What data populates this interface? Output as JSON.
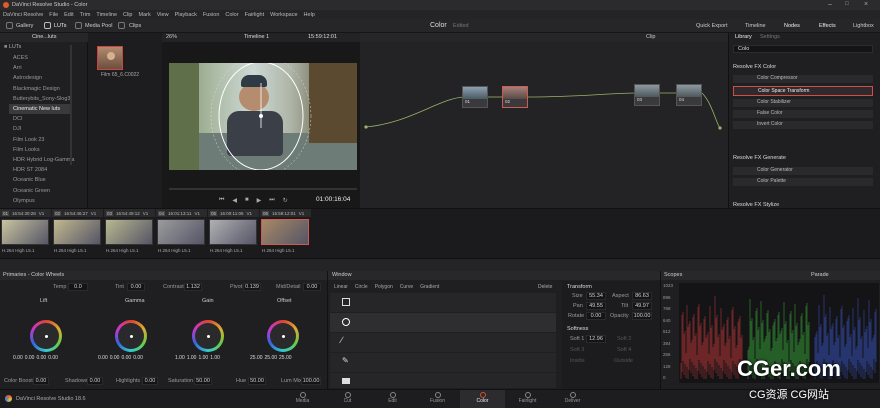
{
  "window": {
    "title": "DaVinci Resolve Studio - Color"
  },
  "menu": [
    "DaVinci Resolve",
    "File",
    "Edit",
    "Trim",
    "Timeline",
    "Clip",
    "Mark",
    "View",
    "Playback",
    "Fusion",
    "Color",
    "Fairlight",
    "Workspace",
    "Help"
  ],
  "toolbar": {
    "gallery": "Gallery",
    "luts": "LUTs",
    "media_pool": "Media Pool",
    "clips": "Clips",
    "page_title": "Color",
    "page_status": "Edited",
    "quick_export": "Quick Export",
    "timeline": "Timeline",
    "nodes": "Nodes",
    "effects": "Effects",
    "lightbox": "Lightbox"
  },
  "lut_panel": {
    "breadcrumb": "Cine...luts",
    "root": "LUTs",
    "items": [
      "ACES",
      "Arri",
      "Astrodesign",
      "Blackmagic Design",
      "Butterybits_Sony-Slog3",
      "Cinematic New luts",
      "DCI",
      "DJI",
      "Film Look 23",
      "Film Looks",
      "HDR Hybrid Log-Gamma",
      "HDR ST 2084",
      "Oceanic Blue",
      "Oceanic Green",
      "Olympus"
    ],
    "selected": "Cinematic New luts",
    "thumb_label": "Film 65_6.C0022"
  },
  "viewer": {
    "zoom": "26%",
    "timeline_name": "Timeline 1",
    "timecode_top": "15:59:12:01",
    "clip_label": "Clip",
    "timecode": "01:00:16:04"
  },
  "nodes": [
    {
      "num": "01"
    },
    {
      "num": "02"
    },
    {
      "num": "03"
    },
    {
      "num": "04"
    }
  ],
  "library": {
    "tab_library": "Library",
    "tab_settings": "Settings",
    "search_value": "Colo",
    "sections": [
      {
        "title": "Resolve FX Color",
        "items": [
          "Color Compressor",
          "Color Space Transform",
          "Color Stabilizer",
          "False Color",
          "Invert Color"
        ]
      },
      {
        "title": "Resolve FX Generate",
        "items": [
          "Color Generator",
          "Color Palette"
        ]
      },
      {
        "title": "Resolve FX Stylize",
        "items": []
      }
    ],
    "highlighted": "Color Space Transform"
  },
  "clips": [
    {
      "num": "01",
      "tc": "16:54:30:28",
      "track": "V1",
      "codec": "H.264 High L5.1"
    },
    {
      "num": "02",
      "tc": "16:54:46:27",
      "track": "V1",
      "codec": "H.264 High L5.1"
    },
    {
      "num": "03",
      "tc": "16:54:49:12",
      "track": "V1",
      "codec": "H.264 High L5.1"
    },
    {
      "num": "04",
      "tc": "16:01:13:11",
      "track": "V1",
      "codec": "H.264 High L5.1"
    },
    {
      "num": "05",
      "tc": "16:00:11:06",
      "track": "V1",
      "codec": "H.264 High L5.1"
    },
    {
      "num": "06",
      "tc": "15:59:12:01",
      "track": "V1",
      "codec": "H.264 High L5.1"
    }
  ],
  "primaries": {
    "title": "Primaries - Color Wheels",
    "temp_label": "Temp",
    "temp": "0.0",
    "tint_label": "Tint",
    "tint": "0.00",
    "contrast_label": "Contrast",
    "contrast": "1.132",
    "pivot_label": "Pivot",
    "pivot": "0.139",
    "middetail_label": "Mid/Detail",
    "middetail": "0.00",
    "wheels": [
      {
        "name": "Lift",
        "vals": [
          "0.00",
          "0.00",
          "0.00",
          "0.00"
        ]
      },
      {
        "name": "Gamma",
        "vals": [
          "0.00",
          "0.00",
          "0.00",
          "0.00"
        ]
      },
      {
        "name": "Gain",
        "vals": [
          "1.00",
          "1.00",
          "1.00",
          "1.00"
        ]
      },
      {
        "name": "Offset",
        "vals": [
          "25.00",
          "25.00",
          "25.00"
        ]
      }
    ],
    "color_boost_label": "Color Boost",
    "color_boost": "0.00",
    "shadows_label": "Shadows",
    "shadows": "0.00",
    "highlights_label": "Highlights",
    "highlights": "0.00",
    "saturation_label": "Saturation",
    "saturation": "50.00",
    "hue_label": "Hue",
    "hue": "50.00",
    "lummix_label": "Lum Mix",
    "lummix": "100.00"
  },
  "window_panel": {
    "title": "Window",
    "tools": [
      "Linear",
      "Circle",
      "Polygon",
      "Curve",
      "Gradient"
    ],
    "delete": "Delete",
    "transform_title": "Transform",
    "size_label": "Size",
    "size": "55.34",
    "aspect_label": "Aspect",
    "aspect": "86.63",
    "pan_label": "Pan",
    "pan": "49.55",
    "tilt_label": "Tilt",
    "tilt": "49.97",
    "rotate_label": "Rotate",
    "rotate": "0.00",
    "opacity_label": "Opacity",
    "opacity": "100.00",
    "softness_title": "Softness",
    "soft1_label": "Soft 1",
    "soft1": "12.96",
    "soft2_label": "Soft 2",
    "soft3_label": "Soft 3",
    "soft4_label": "Soft 4",
    "inside_label": "Inside",
    "outside_label": "Outside"
  },
  "scopes": {
    "title": "Scopes",
    "mode": "Parade",
    "ticks": [
      "1023",
      "896",
      "768",
      "640",
      "512",
      "384",
      "256",
      "128",
      "0"
    ]
  },
  "pages": [
    "Media",
    "Cut",
    "Edit",
    "Fusion",
    "Color",
    "Fairlight",
    "Deliver"
  ],
  "active_page": "Color",
  "status": {
    "app": "DaVinci Resolve Studio 18.6"
  },
  "watermark": {
    "brand": "CGer.com",
    "cn": "CG资源 CG网站"
  }
}
